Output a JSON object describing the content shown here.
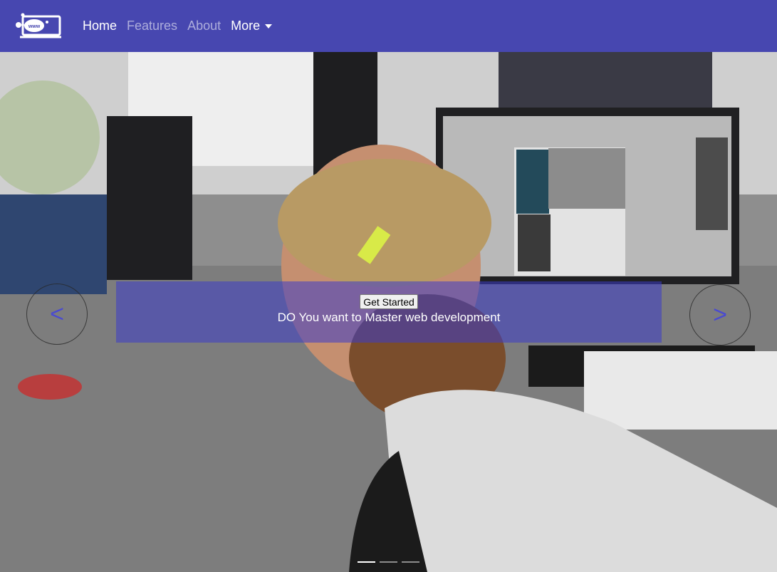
{
  "brand": {
    "icon": "www-logo-icon"
  },
  "nav": {
    "items": [
      {
        "label": "Home",
        "state": "active"
      },
      {
        "label": "Features",
        "state": "muted"
      },
      {
        "label": "About",
        "state": "muted"
      },
      {
        "label": "More",
        "state": "dropdown"
      }
    ]
  },
  "hero": {
    "cta_label": "Get Started",
    "headline": "DO You want to Master web development",
    "prev_label": "<",
    "next_label": ">",
    "indicators": 3,
    "active_indicator": 1
  },
  "colors": {
    "navbar": "#4747b0",
    "caption_band": "rgba(60,60,200,0.55)",
    "control_arrow": "#4a4ad0"
  }
}
